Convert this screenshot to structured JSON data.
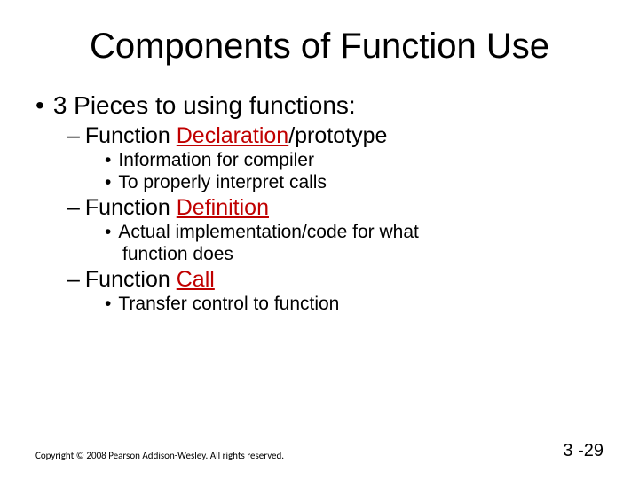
{
  "title": "Components of Function Use",
  "lvl1": {
    "bullet": "•",
    "text": "3 Pieces to using functions:"
  },
  "sec1": {
    "dash": "–",
    "pre": "Function ",
    "kw": "Declaration",
    "post": "/prototype",
    "b1": {
      "dot": "•",
      "text": "Information for compiler"
    },
    "b2": {
      "dot": "•",
      "text": "To properly interpret calls"
    }
  },
  "sec2": {
    "dash": "–",
    "pre": "Function ",
    "kw": "Definition",
    "b1": {
      "dot": "•",
      "line1": "Actual implementation/code for what",
      "line2": "function does"
    }
  },
  "sec3": {
    "dash": "–",
    "pre": "Function ",
    "kw": "Call",
    "b1": {
      "dot": "•",
      "text": "Transfer control to function"
    }
  },
  "footer": {
    "copyright": "Copyright © 2008 Pearson Addison-Wesley. All rights reserved.",
    "page": "3 -29"
  }
}
